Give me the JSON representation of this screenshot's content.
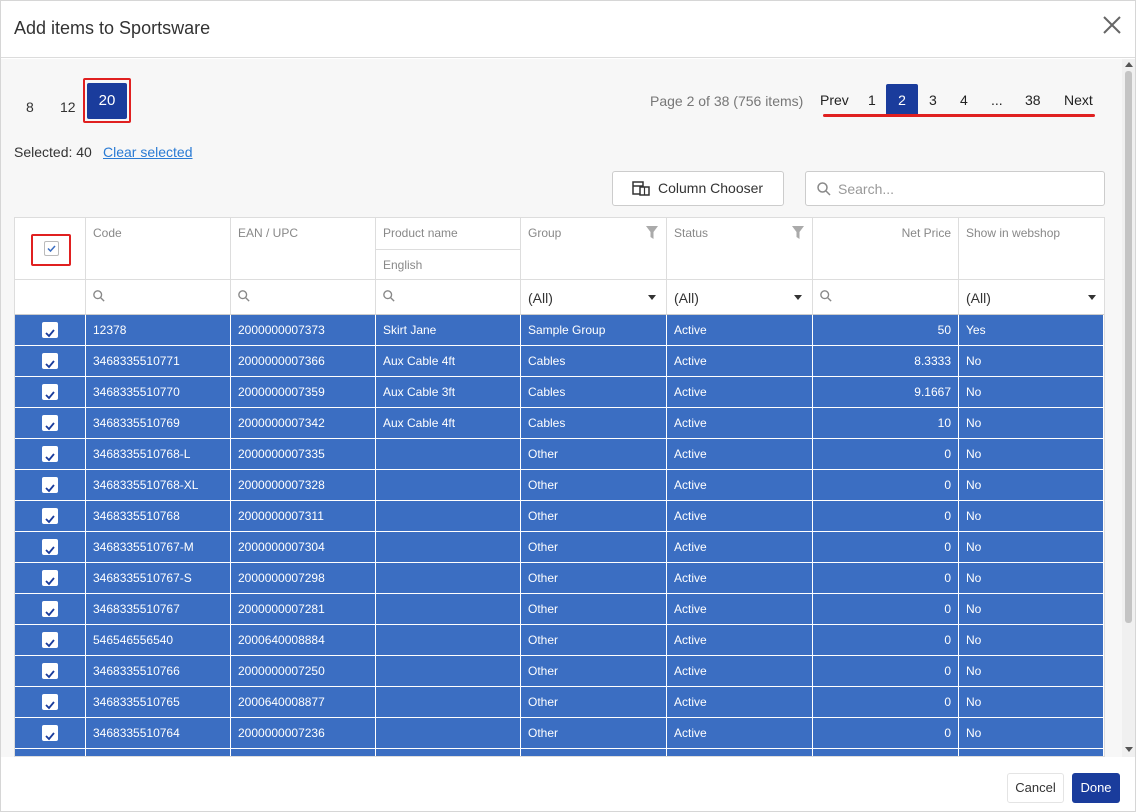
{
  "dialog": {
    "title": "Add items to Sportsware"
  },
  "page_size": {
    "options": [
      "8",
      "12",
      "20"
    ],
    "selected": "20"
  },
  "pagination": {
    "info": "Page 2 of 38 (756 items)",
    "prev": "Prev",
    "next": "Next",
    "pages": [
      "1",
      "2",
      "3",
      "4",
      "...",
      "38"
    ],
    "current": "2"
  },
  "selection": {
    "label": "Selected: 40",
    "clear": "Clear selected"
  },
  "toolbar": {
    "column_chooser": "Column Chooser",
    "search_placeholder": "Search..."
  },
  "grid": {
    "columns": {
      "code": "Code",
      "ean": "EAN / UPC",
      "product_name": "Product name",
      "product_name_sub": "English",
      "group": "Group",
      "status": "Status",
      "net_price": "Net Price",
      "webshop": "Show in webshop"
    },
    "filters": {
      "group": "(All)",
      "status": "(All)",
      "webshop": "(All)"
    },
    "rows": [
      {
        "code": "12378",
        "ean": "2000000007373",
        "name": "Skirt Jane",
        "group": "Sample Group",
        "status": "Active",
        "price": "50",
        "web": "Yes"
      },
      {
        "code": "3468335510771",
        "ean": "2000000007366",
        "name": "Aux Cable 4ft",
        "group": "Cables",
        "status": "Active",
        "price": "8.3333",
        "web": "No"
      },
      {
        "code": "3468335510770",
        "ean": "2000000007359",
        "name": "Aux Cable 3ft",
        "group": "Cables",
        "status": "Active",
        "price": "9.1667",
        "web": "No"
      },
      {
        "code": "3468335510769",
        "ean": "2000000007342",
        "name": "Aux Cable 4ft",
        "group": "Cables",
        "status": "Active",
        "price": "10",
        "web": "No"
      },
      {
        "code": "3468335510768-L",
        "ean": "2000000007335",
        "name": "",
        "group": "Other",
        "status": "Active",
        "price": "0",
        "web": "No"
      },
      {
        "code": "3468335510768-XL",
        "ean": "2000000007328",
        "name": "",
        "group": "Other",
        "status": "Active",
        "price": "0",
        "web": "No"
      },
      {
        "code": "3468335510768",
        "ean": "2000000007311",
        "name": "",
        "group": "Other",
        "status": "Active",
        "price": "0",
        "web": "No"
      },
      {
        "code": "3468335510767-M",
        "ean": "2000000007304",
        "name": "",
        "group": "Other",
        "status": "Active",
        "price": "0",
        "web": "No"
      },
      {
        "code": "3468335510767-S",
        "ean": "2000000007298",
        "name": "",
        "group": "Other",
        "status": "Active",
        "price": "0",
        "web": "No"
      },
      {
        "code": "3468335510767",
        "ean": "2000000007281",
        "name": "",
        "group": "Other",
        "status": "Active",
        "price": "0",
        "web": "No"
      },
      {
        "code": "546546556540",
        "ean": "2000640008884",
        "name": "",
        "group": "Other",
        "status": "Active",
        "price": "0",
        "web": "No"
      },
      {
        "code": "3468335510766",
        "ean": "2000000007250",
        "name": "",
        "group": "Other",
        "status": "Active",
        "price": "0",
        "web": "No"
      },
      {
        "code": "3468335510765",
        "ean": "2000640008877",
        "name": "",
        "group": "Other",
        "status": "Active",
        "price": "0",
        "web": "No"
      },
      {
        "code": "3468335510764",
        "ean": "2000000007236",
        "name": "",
        "group": "Other",
        "status": "Active",
        "price": "0",
        "web": "No"
      }
    ]
  },
  "footer": {
    "cancel": "Cancel",
    "done": "Done"
  },
  "colors": {
    "accent": "#1a3c9c",
    "row_selected": "#3b6ec2",
    "highlight": "#e02020",
    "link": "#2a7bd4"
  }
}
